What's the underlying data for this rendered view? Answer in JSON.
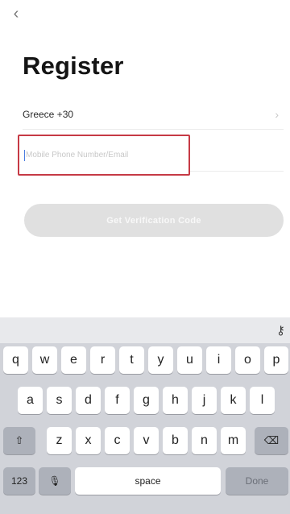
{
  "header": {
    "back_icon": "chevron-left-icon",
    "back_glyph": "‹",
    "title": "Register"
  },
  "country": {
    "label": "Greece +30",
    "chevron_glyph": "›"
  },
  "phone_field": {
    "placeholder": "Mobile Phone Number/Email"
  },
  "verify_button": {
    "label": "Get Verification Code"
  },
  "keyboard": {
    "toolbar_icon": "key-icon",
    "row1": [
      "q",
      "w",
      "e",
      "r",
      "t",
      "y",
      "u",
      "i",
      "o",
      "p"
    ],
    "row2": [
      "a",
      "s",
      "d",
      "f",
      "g",
      "h",
      "j",
      "k",
      "l"
    ],
    "row3": [
      "z",
      "x",
      "c",
      "v",
      "b",
      "n",
      "m"
    ],
    "shift_glyph": "⇧",
    "backspace_glyph": "⌫",
    "numbers_label": "123",
    "mic_glyph": "🎙",
    "space_label": "space",
    "done_label": "Done"
  }
}
